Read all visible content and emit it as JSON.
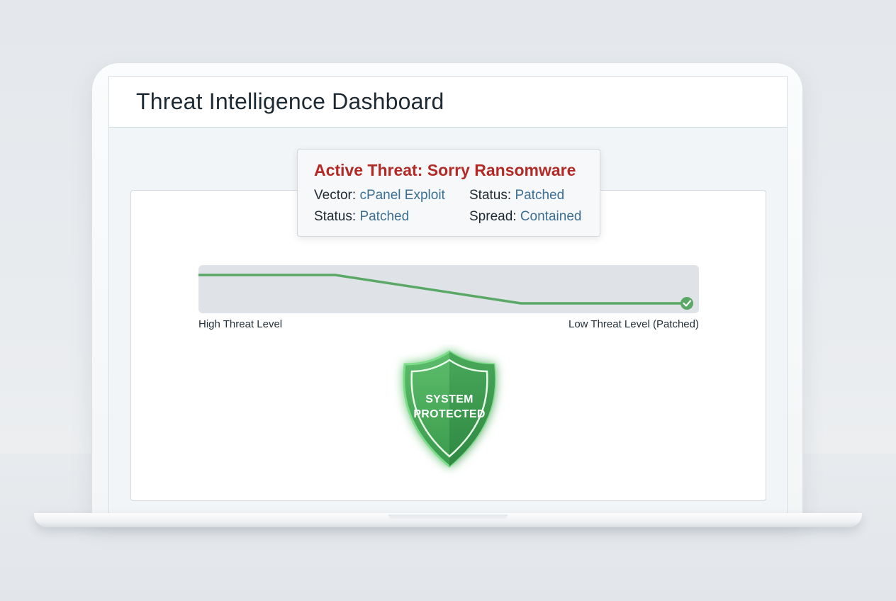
{
  "app": {
    "title": "Threat Intelligence Dashboard"
  },
  "threat": {
    "title": "Active Threat: Sorry Ransomware",
    "fields": [
      {
        "label": "Vector:",
        "value": "cPanel Exploit"
      },
      {
        "label": "Status:",
        "value": "Patched"
      },
      {
        "label": "Status:",
        "value": "Patched"
      },
      {
        "label": "Spread:",
        "value": "Contained"
      }
    ]
  },
  "chart_data": {
    "type": "line",
    "x": [
      0,
      0.28,
      0.66,
      1.0
    ],
    "series": [
      {
        "values": [
          1.0,
          1.0,
          0.2,
          0.2
        ]
      }
    ],
    "xlabel_start": "High Threat Level",
    "xlabel_end": "Low Threat Level (Patched)",
    "ylim": [
      0,
      1.2
    ],
    "end_marker": "check-icon"
  },
  "shield": {
    "line1": "SYSTEM",
    "line2": "PROTECTED",
    "icon": "shield-icon"
  },
  "colors": {
    "threat_red": "#b12a26",
    "value_blue": "#3b6f93",
    "line_green": "#5aa866",
    "shield_green": "#3f9a50"
  }
}
